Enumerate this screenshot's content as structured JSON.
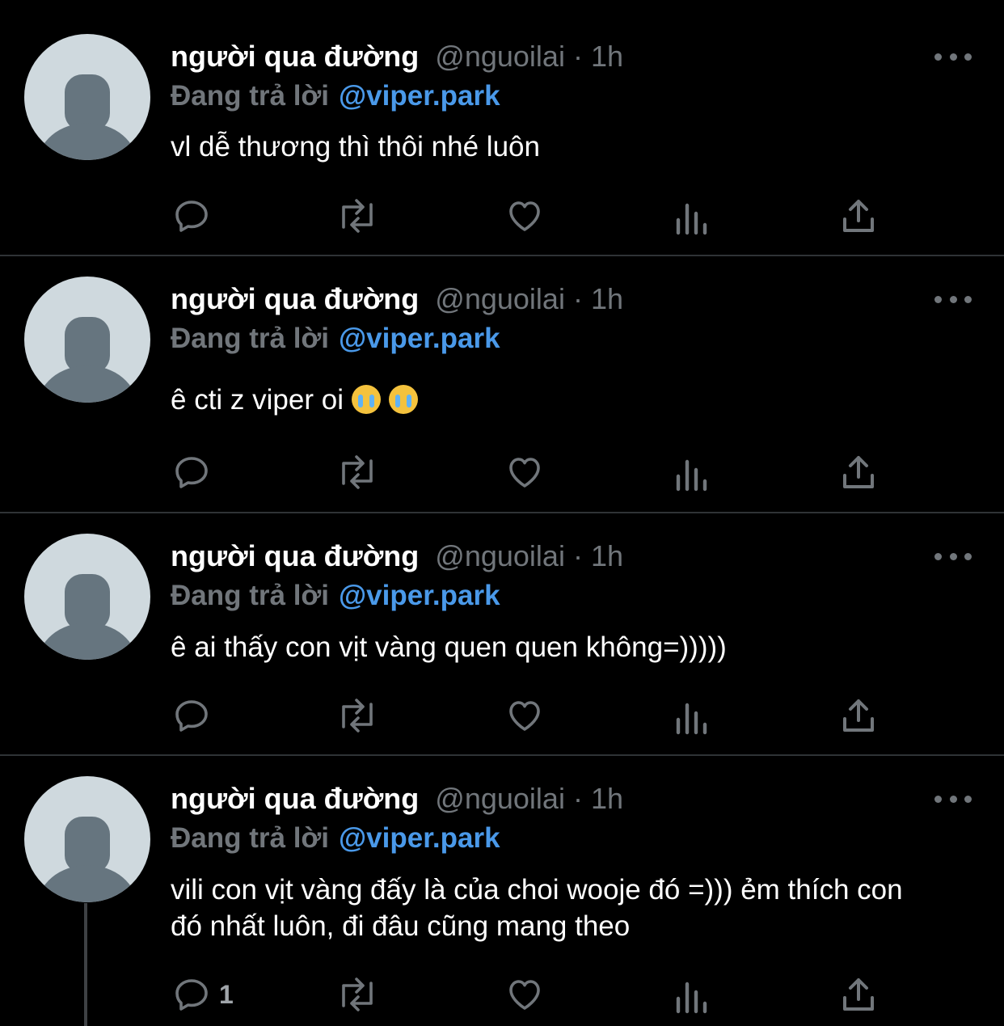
{
  "tweets": [
    {
      "name": "người qua đường",
      "handle": "@nguoilai",
      "separator": "·",
      "time": "1h",
      "replying_prefix": "Đang trả lời",
      "replying_to": "@viper.park",
      "text": "vl dễ thương thì thôi nhé luôn",
      "reply_count": ""
    },
    {
      "name": "người qua đường",
      "handle": "@nguoilai",
      "separator": "·",
      "time": "1h",
      "replying_prefix": "Đang trả lời",
      "replying_to": "@viper.park",
      "text": "ê cti z viper oi",
      "emojis": [
        "loudly-crying-face-icon",
        "loudly-crying-face-icon"
      ],
      "reply_count": ""
    },
    {
      "name": "người qua đường",
      "handle": "@nguoilai",
      "separator": "·",
      "time": "1h",
      "replying_prefix": "Đang trả lời",
      "replying_to": "@viper.park",
      "text": "ê ai thấy con vịt vàng quen quen không=)))))",
      "reply_count": ""
    },
    {
      "name": "người qua đường",
      "handle": "@nguoilai",
      "separator": "·",
      "time": "1h",
      "replying_prefix": "Đang trả lời",
      "replying_to": "@viper.park",
      "text": "vili con vịt vàng đấy là của choi wooje đó =))) ẻm thích con đó nhất luôn, đi đâu cũng mang theo",
      "reply_count": "1"
    }
  ],
  "actions": [
    "reply-icon",
    "retweet-icon",
    "like-icon",
    "views-icon",
    "share-icon"
  ],
  "colors": {
    "background": "#000000",
    "mention": "#4a99e9",
    "muted": "#71767b",
    "divider": "#2f3336"
  }
}
